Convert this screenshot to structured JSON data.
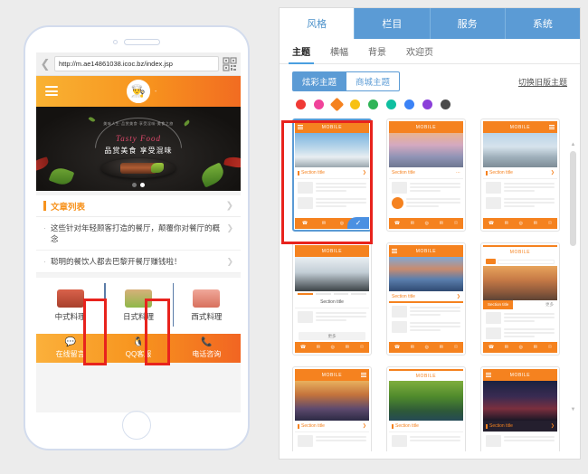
{
  "phone": {
    "browser": {
      "back_icon": "chevron-left-icon",
      "url": "http://m.ae14861038.icoc.bz/index.jsp",
      "qr_icon": "qr-code-icon"
    },
    "site_header": {
      "menu_icon": "hamburger-menu-icon",
      "logo_glyph": "👨‍🍳",
      "title_mini": "-"
    },
    "banner": {
      "arc_text": "美味人生·品赏美食·享受淫味·美食之旅",
      "script": "Tasty Food",
      "subtitle": "品赏美食 享受混味",
      "dots": 2,
      "active_dot": 1
    },
    "article_list": {
      "title": "文章列表",
      "chevron_icon": "chevron-right-icon",
      "items": [
        "这些针对年轻顾客打造的餐厅，颠覆你对餐厅的概念",
        "聪明的餐饮人都去巴黎开餐厅赚钱啦！"
      ]
    },
    "categories": [
      {
        "label": "中式料理",
        "icon": "chinese-food-icon"
      },
      {
        "label": "日式料理",
        "icon": "japanese-food-icon"
      },
      {
        "label": "西式料理",
        "icon": "western-food-icon"
      }
    ],
    "bottom_nav": [
      {
        "label": "在线留言",
        "glyph": "💬",
        "icon": "message-icon"
      },
      {
        "label": "QQ客服",
        "glyph": "🐧",
        "icon": "qq-penguin-icon"
      },
      {
        "label": "电话咨询",
        "glyph": "📞",
        "icon": "phone-icon"
      }
    ]
  },
  "editor": {
    "main_tabs": [
      {
        "label": "风格",
        "active": true
      },
      {
        "label": "栏目",
        "active": false
      },
      {
        "label": "服务",
        "active": false
      },
      {
        "label": "系统",
        "active": false
      }
    ],
    "sub_tabs": [
      {
        "label": "主题",
        "active": true
      },
      {
        "label": "横幅",
        "active": false
      },
      {
        "label": "背景",
        "active": false
      },
      {
        "label": "欢迎页",
        "active": false
      }
    ],
    "theme_toggle": [
      {
        "label": "炫彩主题",
        "active": true
      },
      {
        "label": "商城主题",
        "active": false
      }
    ],
    "legacy_link": "切换旧版主题",
    "swatches": [
      {
        "color": "#f03a35",
        "selected": false
      },
      {
        "color": "#f0439a",
        "selected": false
      },
      {
        "color": "#f5821f",
        "selected": true
      },
      {
        "color": "#f7c113",
        "selected": false
      },
      {
        "color": "#2fb457",
        "selected": false
      },
      {
        "color": "#0fbfa0",
        "selected": false
      },
      {
        "color": "#3b82f6",
        "selected": false
      },
      {
        "color": "#8b3fd9",
        "selected": false
      },
      {
        "color": "#4a4a4a",
        "selected": false
      }
    ],
    "templates": [
      {
        "id": 1,
        "header": "MOBILE",
        "section": "Section title",
        "selected": true,
        "photo": "snowy-mountain-photo",
        "layout": "header-photo-section-rows-footer",
        "check_icon": "check-icon"
      },
      {
        "id": 2,
        "header": "MOBILE",
        "section": "Section title",
        "selected": false,
        "photo": "sunset-beach-photo",
        "layout": "header-photo-section-rows-footer",
        "more_glyph": "⋯"
      },
      {
        "id": 3,
        "header": "MOBILE",
        "section": "Section title",
        "selected": false,
        "photo": "winter-road-photo",
        "layout": "header-photo-section-rows-footer"
      },
      {
        "id": 4,
        "header": "MOBILE",
        "section": "Section title",
        "selected": false,
        "photo": "snow-peak-photo",
        "layout": "header-photo-nav-section-rows-more-footer",
        "more_label": "更多"
      },
      {
        "id": 5,
        "header": "MOBILE",
        "section": "Section title",
        "selected": false,
        "photo": "lake-mountain-photo",
        "layout": "header-photo-section-rows-footer"
      },
      {
        "id": 6,
        "header": "MOBILE",
        "section": "Section title",
        "selected": false,
        "photo": "desert-road-photo",
        "layout": "header-search-photo-tabs-rows-footer",
        "tab_right": "更多"
      },
      {
        "id": 7,
        "header": "MOBILE",
        "section": "Section title",
        "selected": false,
        "photo": "ocean-rock-sunset-photo",
        "layout": "header-photo-section"
      },
      {
        "id": 8,
        "header": "MOBILE",
        "section": "Section title",
        "selected": false,
        "photo": "green-frog-photo",
        "layout": "plainheader-photo-section"
      },
      {
        "id": 9,
        "header": "MOBILE",
        "section": "Section title",
        "selected": false,
        "photo": "night-city-photo",
        "layout": "header-photo-section"
      }
    ],
    "scrollbar": {
      "up_icon": "chevron-up-icon",
      "down_icon": "chevron-down-icon"
    }
  },
  "annotations": {
    "color": "#e8231d",
    "boxes": [
      {
        "name": "divider-left-highlight"
      },
      {
        "name": "divider-right-highlight"
      },
      {
        "name": "selected-template-highlight"
      }
    ]
  }
}
